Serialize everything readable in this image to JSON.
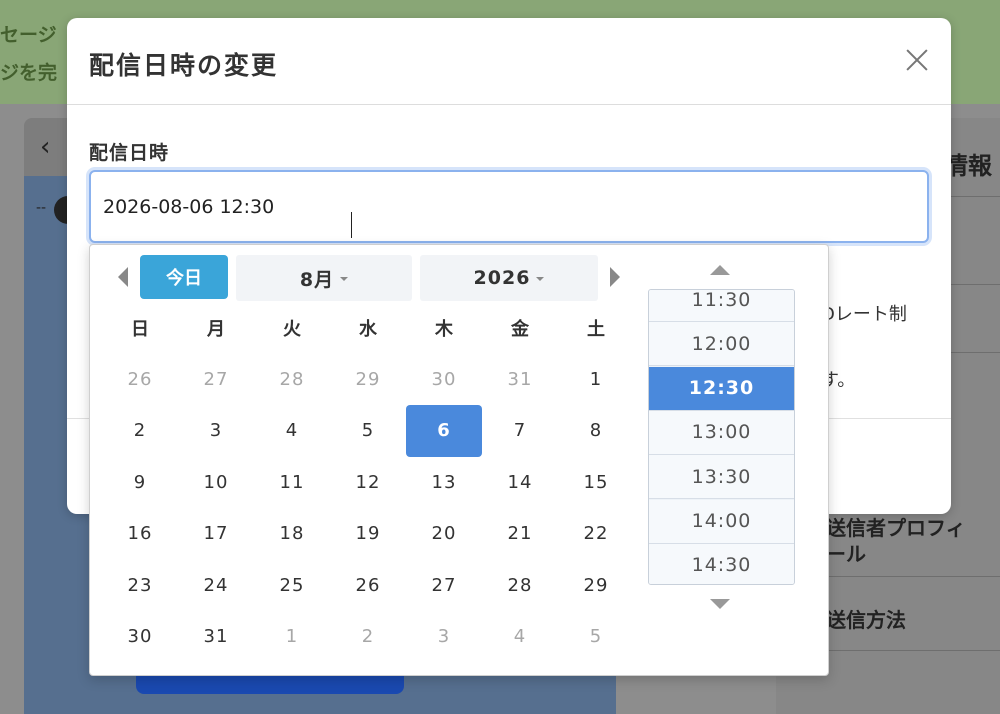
{
  "background": {
    "banner_line1": "セージ",
    "banner_line2": "ジを完",
    "back_icon": "chevron-left-icon",
    "right_title": "情報",
    "right_item_profile_1": "送信者プロフィ",
    "right_item_profile_2": "ール",
    "right_item_method": "送信方法"
  },
  "modal": {
    "title": "配信日時の変更",
    "field_label": "配信日時",
    "input_value": "2026-08-06 12:30",
    "side_text_1": "Dレート制",
    "side_text_2": "す。",
    "close_icon": "close-icon"
  },
  "calendar": {
    "today_label": "今日",
    "month_label": "8月",
    "year_label": "2026",
    "weekdays": [
      "日",
      "月",
      "火",
      "水",
      "木",
      "金",
      "土"
    ],
    "weeks": [
      [
        "26",
        "27",
        "28",
        "29",
        "30",
        "31",
        "1"
      ],
      [
        "2",
        "3",
        "4",
        "5",
        "6",
        "7",
        "8"
      ],
      [
        "9",
        "10",
        "11",
        "12",
        "13",
        "14",
        "15"
      ],
      [
        "16",
        "17",
        "18",
        "19",
        "20",
        "21",
        "22"
      ],
      [
        "23",
        "24",
        "25",
        "26",
        "27",
        "28",
        "29"
      ],
      [
        "30",
        "31",
        "1",
        "2",
        "3",
        "4",
        "5"
      ]
    ],
    "selected_day": "6",
    "times": [
      "11:30",
      "12:00",
      "12:30",
      "13:00",
      "13:30",
      "14:00",
      "14:30"
    ],
    "selected_time": "12:30",
    "colors": {
      "accent": "#4a89dc",
      "today_button": "#3aa5d9",
      "muted_text": "#a7a7a7"
    }
  }
}
